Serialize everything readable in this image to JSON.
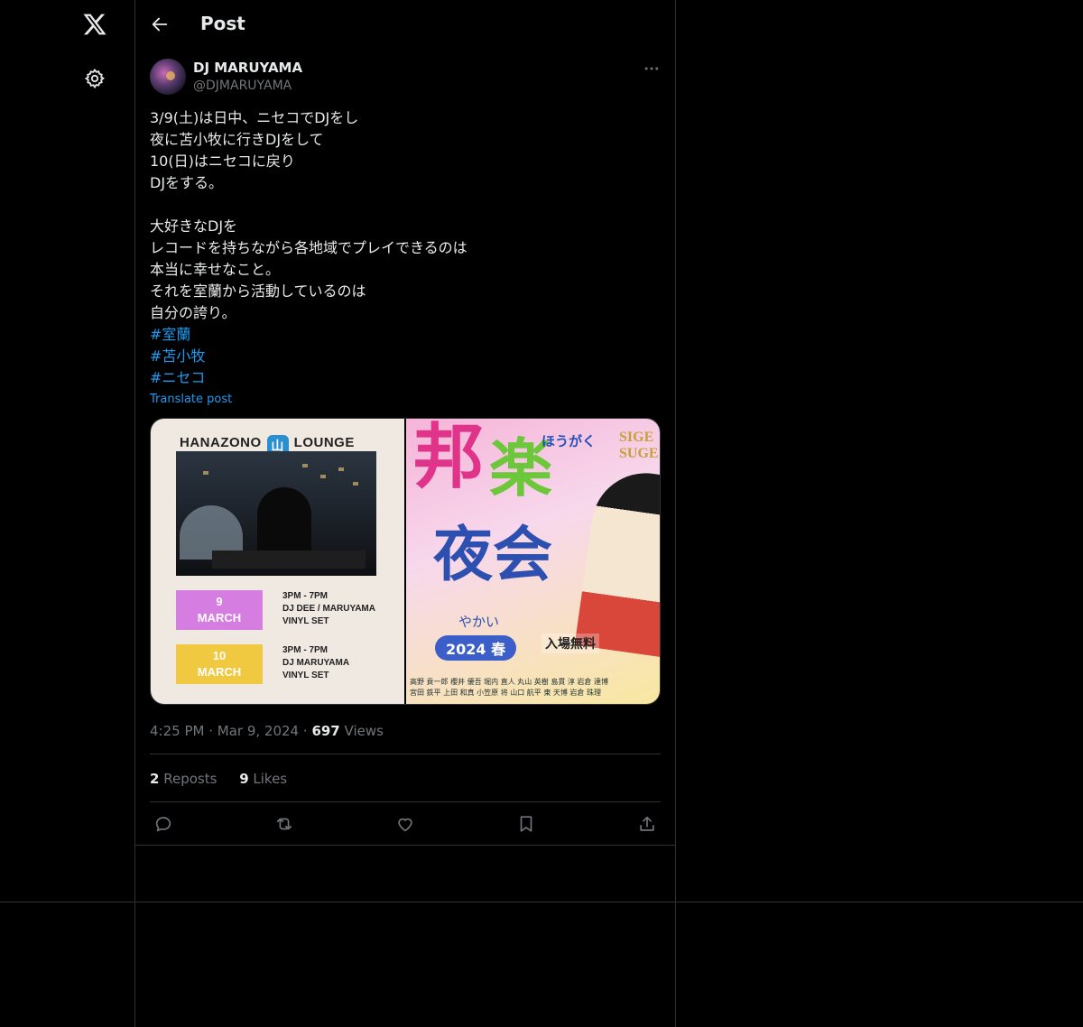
{
  "header": {
    "title": "Post"
  },
  "nav": {
    "logo_icon": "x-logo-icon",
    "settings_icon": "gear-icon",
    "back_icon": "arrow-left-icon"
  },
  "author": {
    "display_name": "DJ MARUYAMA",
    "handle": "@DJMARUYAMA"
  },
  "post": {
    "lines": [
      "3/9(土)は日中、ニセコでDJをし",
      "夜に苫小牧に行きDJをして",
      "10(日)はニセコに戻り",
      "DJをする。",
      "",
      "大好きなDJを",
      "レコードを持ちながら各地域でプレイできるのは",
      "本当に幸せなこと。",
      "それを室蘭から活動しているのは",
      "自分の誇り。"
    ],
    "hashtags": [
      "#室蘭",
      "#苫小牧",
      "#ニセコ"
    ],
    "translate_label": "Translate post"
  },
  "media": {
    "left": {
      "title_left": "HANAZONO",
      "title_mark": "山",
      "title_right": "LOUNGE",
      "date1_day": "9",
      "date1_month": "MARCH",
      "date1_time": "3PM - 7PM",
      "date1_dj": "DJ DEE / MARUYAMA",
      "date1_set": "VINYL SET",
      "date2_day": "10",
      "date2_month": "MARCH",
      "date2_time": "3PM - 7PM",
      "date2_dj": "DJ MARUYAMA",
      "date2_set": "VINYL SET"
    },
    "right": {
      "char1": "邦",
      "char2": "楽",
      "kana_top": "ほうがく",
      "chars3": "夜会",
      "kana_bottom": "やかい",
      "year": "2024 春",
      "free": "入場無料",
      "brand": "SIGE SUGE",
      "names1": "高野 貢一郎  櫻井 優吾  堀内 直人  丸山 英樹  島貫 淳  岩倉 達博",
      "names2": "宮田 鉄平  上田 和真  小笠原 将  山口 航平  東 天博  岩倉 珠理"
    }
  },
  "meta": {
    "time": "4:25 PM",
    "date": "Mar 9, 2024",
    "views_count": "697",
    "views_label": "Views"
  },
  "stats": {
    "reposts_count": "2",
    "reposts_label": "Reposts",
    "likes_count": "9",
    "likes_label": "Likes"
  },
  "actions": [
    "reply-icon",
    "repost-icon",
    "like-icon",
    "bookmark-icon",
    "share-icon"
  ],
  "colors": {
    "background": "#000000",
    "text": "#e7e9ea",
    "muted": "#71767b",
    "link": "#1d9bf0",
    "border": "#2f3336"
  }
}
